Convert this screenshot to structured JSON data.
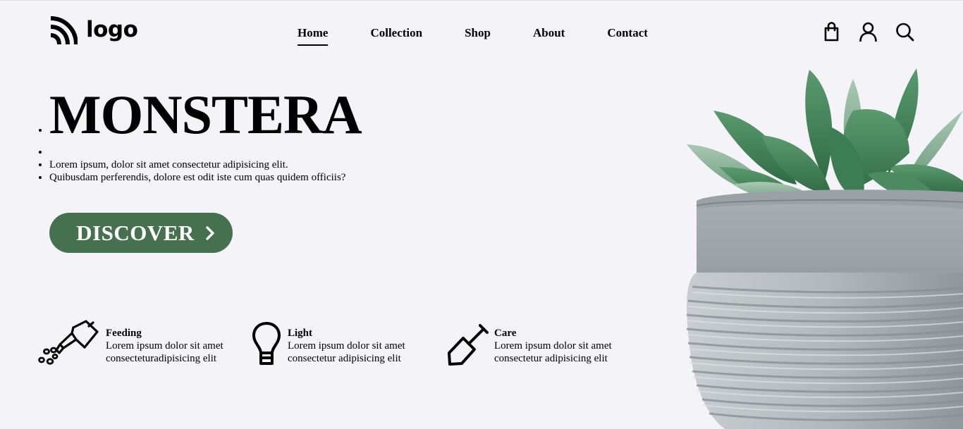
{
  "header": {
    "logo_text": "logo",
    "logo_icon": "rss-wave-logo-icon",
    "nav": [
      {
        "label": "Home",
        "active": true
      },
      {
        "label": "Collection",
        "active": false
      },
      {
        "label": "Shop",
        "active": false
      },
      {
        "label": "About",
        "active": false
      },
      {
        "label": "Contact",
        "active": false
      }
    ],
    "icons": [
      "shopping-bag-icon",
      "user-icon",
      "search-icon"
    ]
  },
  "hero": {
    "title": "MONSTERA",
    "lines": [
      "Lorem ipsum, dolor sit amet consectetur adipisicing elit.",
      "Quibusdam perferendis, dolore est odit iste cum quas quidem officiis?"
    ],
    "cta_label": "DISCOVER",
    "cta_icon": "chevron-right-icon"
  },
  "features": [
    {
      "icon": "watering-can-icon",
      "title": "Feeding",
      "line1": "Lorem ipsum dolor sit amet",
      "line2": "consecteturadipisicing elit"
    },
    {
      "icon": "light-bulb-icon",
      "title": "Light",
      "line1": "Lorem ipsum dolor sit amet",
      "line2": "consectetur adipisicing elit"
    },
    {
      "icon": "shovel-icon",
      "title": "Care",
      "line1": "Lorem ipsum dolor sit amet",
      "line2": "consectetur adipisicing elit"
    }
  ],
  "colors": {
    "background": "#f4f3f8",
    "accent": "#46714f",
    "text": "#000000"
  },
  "image": {
    "subject": "succulent-in-concrete-pot"
  }
}
